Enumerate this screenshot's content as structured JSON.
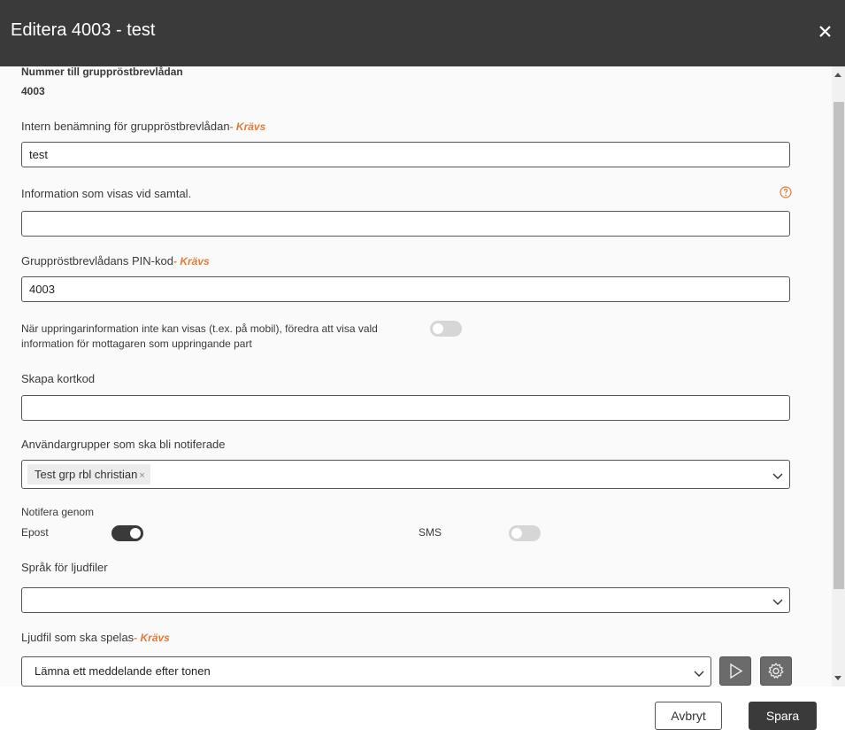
{
  "dialog": {
    "title": "Editera 4003 - test"
  },
  "fields": {
    "number_label": "Nummer till gruppröstbrevlådan",
    "number_value": "4003",
    "name_label": "Intern benämning för gruppröstbrevlådan",
    "name_value": "test",
    "info_label": "Information som visas vid samtal.",
    "info_value": "",
    "pin_label": "Gruppröstbrevlådans PIN-kod",
    "pin_value": "4003",
    "caller_info_label_line1": "När uppringarinformation inte kan visas (t.ex. på mobil), föredra att visa vald",
    "caller_info_label_line2": "information för mottagaren som uppringande part",
    "caller_info_enabled": false,
    "shortcode_label": "Skapa kortkod",
    "shortcode_value": "",
    "usergroups_label": "Användargrupper som ska bli notiferade",
    "usergroups_selected": [
      "Test grp rbl christian"
    ],
    "notify_label": "Notifera genom",
    "notify_email_label": "Epost",
    "notify_email_enabled": true,
    "notify_sms_label": "SMS",
    "notify_sms_enabled": false,
    "language_label": "Språk för ljudfiler",
    "language_value": "",
    "audio_label": "Ljudfil som ska spelas",
    "audio_value": "Lämna ett meddelande efter tonen"
  },
  "required_text": "- Krävs",
  "icons": {
    "close": "close-icon",
    "help": "help-circle-icon",
    "chevron": "chevron-down-icon",
    "play": "play-icon",
    "settings": "gear-icon",
    "chip_remove": "×"
  },
  "footer": {
    "cancel_label": "Avbryt",
    "save_label": "Spara"
  },
  "colors": {
    "header_bg": "#3a3a3a",
    "required": "#e07b39",
    "primary_button": "#3a3a3a"
  }
}
